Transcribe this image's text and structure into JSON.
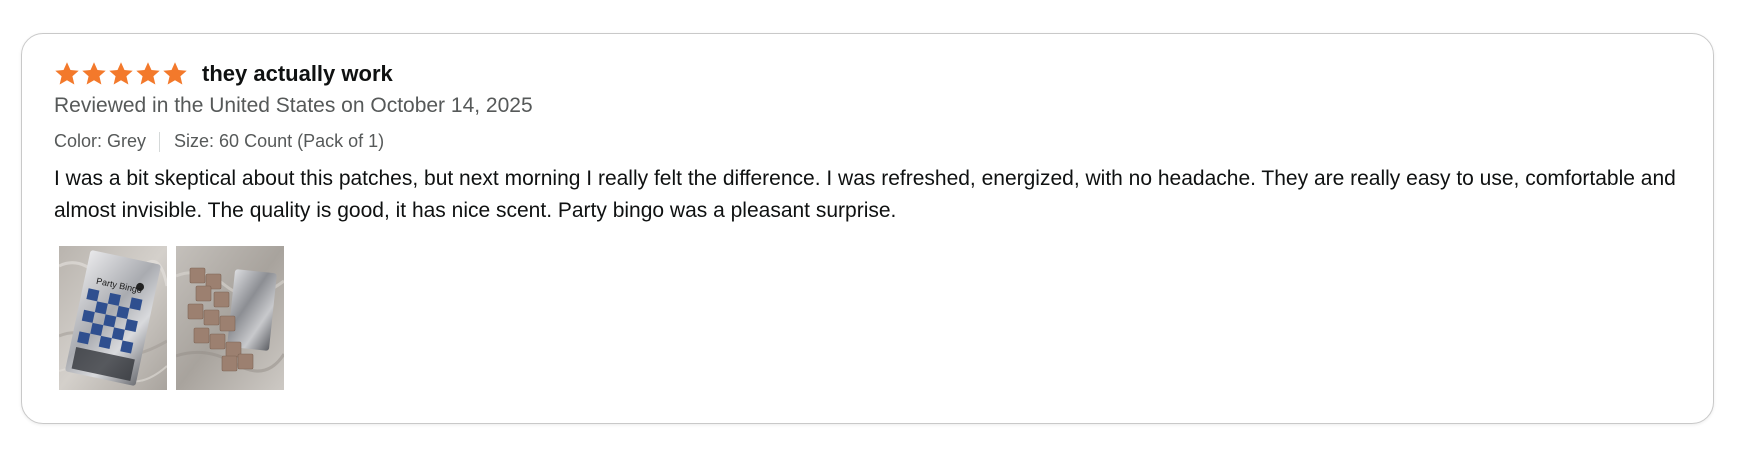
{
  "review": {
    "rating": 5,
    "rating_max": 5,
    "star_color": "#f3792b",
    "star_icons": [
      "star-filled-icon",
      "star-filled-icon",
      "star-filled-icon",
      "star-filled-icon",
      "star-filled-icon"
    ],
    "title": "they actually work",
    "date_line": "Reviewed in the United States on October 14, 2025",
    "color_variant": "Color: Grey",
    "size_variant": "Size: 60 Count (Pack of 1)",
    "body": "I was a bit skeptical about this patches, but next morning I really felt the difference. I was refreshed, energized, with no headache. They are really easy to use, comfortable and almost invisible. The quality is good, it has nice scent. Party bingo was a pleasant surprise.",
    "photos": [
      {
        "name": "review-photo-1",
        "label": "Party Bingo"
      },
      {
        "name": "review-photo-2"
      }
    ]
  }
}
